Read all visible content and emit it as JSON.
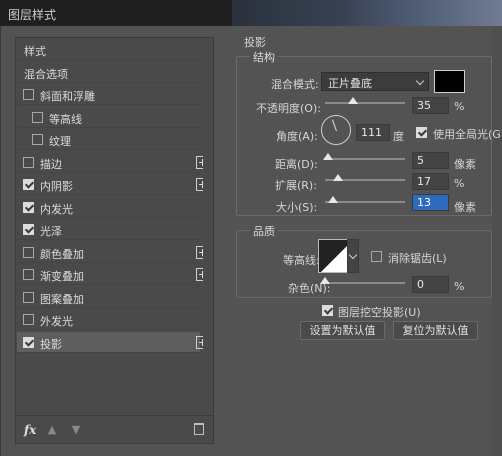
{
  "window": {
    "title": "图层样式"
  },
  "left_panel": {
    "items": [
      {
        "label": "样式",
        "checkbox": null,
        "plus": false,
        "selected": false,
        "indent": false
      },
      {
        "label": "混合选项",
        "checkbox": null,
        "plus": false,
        "selected": false,
        "indent": false
      },
      {
        "label": "斜面和浮雕",
        "checkbox": false,
        "plus": false,
        "selected": false,
        "indent": false
      },
      {
        "label": "等高线",
        "checkbox": false,
        "plus": false,
        "selected": false,
        "indent": true
      },
      {
        "label": "纹理",
        "checkbox": false,
        "plus": false,
        "selected": false,
        "indent": true
      },
      {
        "label": "描边",
        "checkbox": false,
        "plus": true,
        "selected": false,
        "indent": false
      },
      {
        "label": "内阴影",
        "checkbox": true,
        "plus": true,
        "selected": false,
        "indent": false
      },
      {
        "label": "内发光",
        "checkbox": true,
        "plus": false,
        "selected": false,
        "indent": false
      },
      {
        "label": "光泽",
        "checkbox": true,
        "plus": false,
        "selected": false,
        "indent": false
      },
      {
        "label": "颜色叠加",
        "checkbox": false,
        "plus": true,
        "selected": false,
        "indent": false
      },
      {
        "label": "渐变叠加",
        "checkbox": false,
        "plus": true,
        "selected": false,
        "indent": false
      },
      {
        "label": "图案叠加",
        "checkbox": false,
        "plus": false,
        "selected": false,
        "indent": false
      },
      {
        "label": "外发光",
        "checkbox": false,
        "plus": false,
        "selected": false,
        "indent": false
      },
      {
        "label": "投影",
        "checkbox": true,
        "plus": true,
        "selected": true,
        "indent": false
      }
    ],
    "fx_label": "fx"
  },
  "drop_shadow": {
    "section_title": "投影",
    "structure": {
      "title": "结构",
      "blend_mode_label": "混合模式:",
      "blend_mode_value": "正片叠底",
      "shadow_color": "#000000",
      "opacity_label": "不透明度(O):",
      "opacity_value": "35",
      "opacity_unit": "%",
      "angle_label": "角度(A):",
      "angle_value": "111",
      "angle_unit": "度",
      "global_light_label": "使用全局光(G)",
      "global_light_checked": true,
      "distance_label": "距离(D):",
      "distance_value": "5",
      "distance_unit": "像素",
      "spread_label": "扩展(R):",
      "spread_value": "17",
      "spread_unit": "%",
      "size_label": "大小(S):",
      "size_value": "13",
      "size_unit": "像素"
    },
    "quality": {
      "title": "品质",
      "contour_label": "等高线:",
      "antialias_label": "消除锯齿(L)",
      "antialias_checked": false,
      "noise_label": "杂色(N):",
      "noise_value": "0",
      "noise_unit": "%"
    },
    "knockout_label": "图层挖空投影(U)",
    "knockout_checked": true,
    "make_default_label": "设置为默认值",
    "reset_default_label": "复位为默认值"
  }
}
